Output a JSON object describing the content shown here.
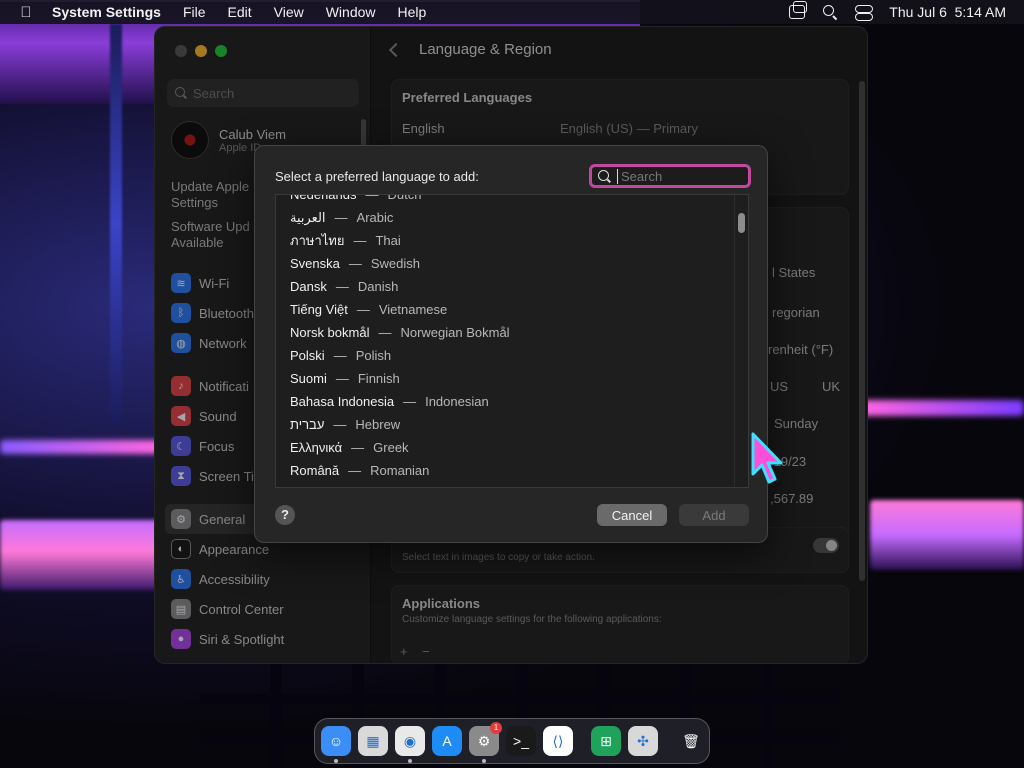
{
  "menubar": {
    "app_name": "System Settings",
    "menus": [
      "File",
      "Edit",
      "View",
      "Window",
      "Help"
    ],
    "clock": "Thu Jul 6  5:14 AM"
  },
  "sidebar": {
    "search_placeholder": "Search",
    "user_name": "Calub Viem",
    "user_sub": "Apple ID",
    "update_line1": "Update Apple",
    "update_line2": "Settings",
    "software_line1": "Software Upd",
    "software_line2": "Available",
    "group1": [
      {
        "label": "Wi-Fi",
        "icon": "wifi-icon",
        "color": "#2f7bf5"
      },
      {
        "label": "Bluetooth",
        "icon": "bluetooth-icon",
        "color": "#2f7bf5"
      },
      {
        "label": "Network",
        "icon": "globe-icon",
        "color": "#2f7bf5"
      }
    ],
    "group2": [
      {
        "label": "Notificati",
        "icon": "bell-icon",
        "color": "#e5484d"
      },
      {
        "label": "Sound",
        "icon": "speaker-icon",
        "color": "#e5484d"
      },
      {
        "label": "Focus",
        "icon": "moon-icon",
        "color": "#5e5ce6"
      },
      {
        "label": "Screen Ti",
        "icon": "hourglass-icon",
        "color": "#5e5ce6"
      }
    ],
    "group3": [
      {
        "label": "General",
        "icon": "gear-icon",
        "color": "#8e8e93"
      },
      {
        "label": "Appearance",
        "icon": "appearance-icon",
        "color": "#1c1c1e"
      },
      {
        "label": "Accessibility",
        "icon": "accessibility-icon",
        "color": "#2f7bf5"
      },
      {
        "label": "Control Center",
        "icon": "control-center-icon",
        "color": "#8e8e93"
      },
      {
        "label": "Siri & Spotlight",
        "icon": "siri-icon",
        "color": "#b04aeb"
      }
    ]
  },
  "main": {
    "title": "Language & Region",
    "preferred_title": "Preferred Languages",
    "pref_lang": "English",
    "pref_lang_detail": "English (US) — Primary",
    "region_values": [
      "l States",
      "regorian",
      "renheit (°F)",
      "US",
      "UK",
      "Sunday",
      "/19/23",
      ",567.89"
    ],
    "live_text_sub": "Select text in images to copy or take action.",
    "apps_title": "Applications",
    "apps_sub": "Customize language settings for the following applications:",
    "add": "+",
    "remove": "−"
  },
  "modal": {
    "title": "Select a preferred language to add:",
    "search_placeholder": "Search",
    "languages": [
      {
        "native": "Nederlands",
        "english": "Dutch"
      },
      {
        "native": "العربية",
        "english": "Arabic"
      },
      {
        "native": "ภาษาไทย",
        "english": "Thai"
      },
      {
        "native": "Svenska",
        "english": "Swedish"
      },
      {
        "native": "Dansk",
        "english": "Danish"
      },
      {
        "native": "Tiếng Việt",
        "english": "Vietnamese"
      },
      {
        "native": "Norsk bokmål",
        "english": "Norwegian Bokmål"
      },
      {
        "native": "Polski",
        "english": "Polish"
      },
      {
        "native": "Suomi",
        "english": "Finnish"
      },
      {
        "native": "Bahasa Indonesia",
        "english": "Indonesian"
      },
      {
        "native": "עברית",
        "english": "Hebrew"
      },
      {
        "native": "Ελληνικά",
        "english": "Greek"
      },
      {
        "native": "Română",
        "english": "Romanian"
      }
    ],
    "dash": "—",
    "help": "?",
    "cancel": "Cancel",
    "add": "Add"
  },
  "dock": {
    "apps": [
      {
        "name": "finder-icon",
        "color": "#3a8ef6",
        "glyph": "☺",
        "running": true
      },
      {
        "name": "launchpad-icon",
        "color": "#d9d9d9",
        "glyph": "▦",
        "running": false
      },
      {
        "name": "chrome-icon",
        "color": "#e9e9e9",
        "glyph": "◉",
        "running": true
      },
      {
        "name": "app-store-icon",
        "color": "#1e8cf5",
        "glyph": "A",
        "running": false
      },
      {
        "name": "system-settings-icon",
        "color": "#8a8a8a",
        "glyph": "⚙",
        "running": true,
        "badge": "1"
      },
      {
        "name": "terminal-icon",
        "color": "#1a1a1a",
        "glyph": ">_",
        "running": false
      },
      {
        "name": "vscode-icon",
        "color": "#ffffff",
        "glyph": "⟨⟩",
        "running": false
      }
    ],
    "apps2": [
      {
        "name": "table-app-icon",
        "color": "#1fa35a",
        "glyph": "⊞",
        "running": false
      },
      {
        "name": "compressor-icon",
        "color": "#d8d8d8",
        "glyph": "✣",
        "running": false
      }
    ],
    "trash": {
      "name": "trash-icon",
      "color": "#9aa0a6",
      "glyph": "🗑"
    }
  }
}
